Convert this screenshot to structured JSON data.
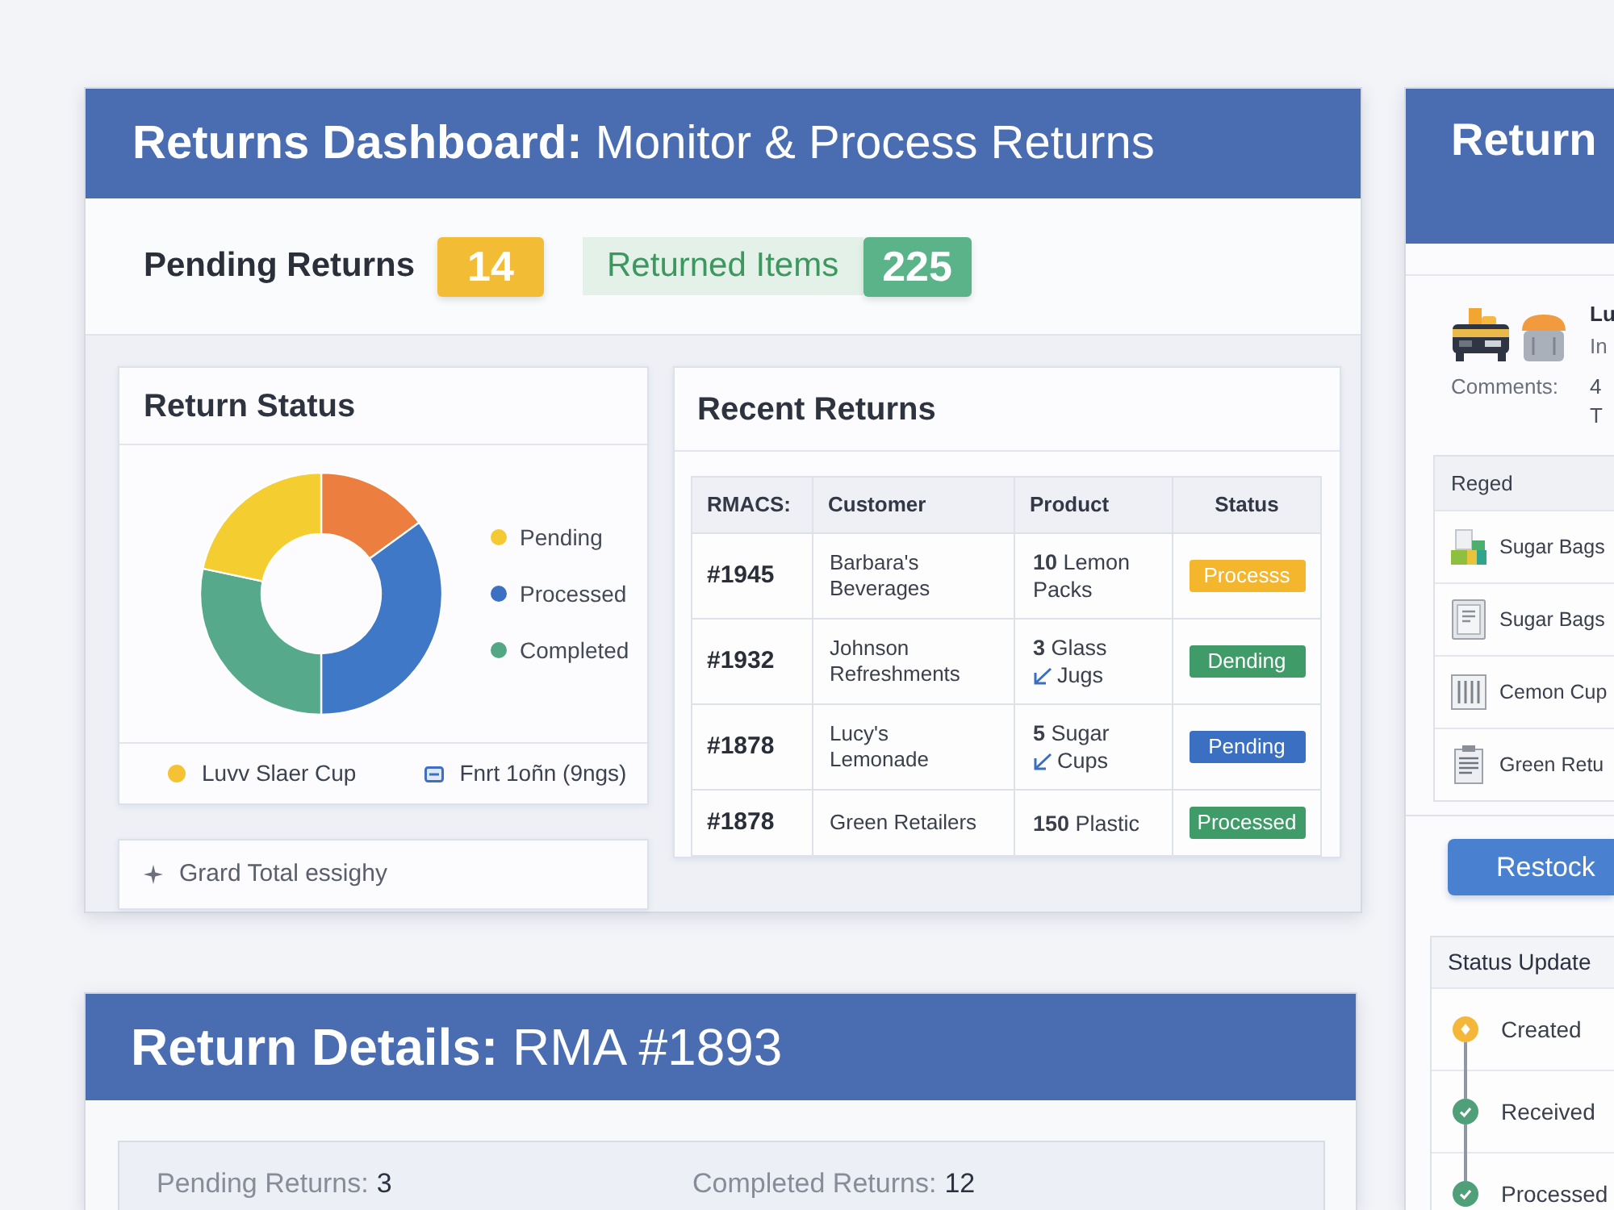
{
  "dashboard": {
    "title": "**Returns Dashboard:** Monitor & Process Returns",
    "stats": [
      {
        "kind": "plain",
        "label": "Pending Returns",
        "value": "14",
        "color": "#f2bc34"
      },
      {
        "kind": "tinted",
        "label": "Returned Items",
        "value": "225",
        "color": "#5bb489"
      }
    ],
    "return_status": {
      "title": "Return Status",
      "legend": [
        {
          "label": "Pending",
          "color": "#f5c933"
        },
        {
          "label": "Processed",
          "color": "#3c70c2"
        },
        {
          "label": "Completed",
          "color": "#52a784"
        }
      ],
      "footer": [
        {
          "kind": "dot",
          "text": "Luvv Slaer Cup",
          "color": "#f4c233"
        },
        {
          "kind": "card",
          "text": "Fnrt 1oñn (9ngs)",
          "color": "#3f6fc4"
        }
      ]
    },
    "grand_total": {
      "text": "Grard Total essighy"
    },
    "recent_returns": {
      "title": "Recent Returns",
      "columns": [
        "RMACS:",
        "Customer",
        "Product",
        "Status"
      ],
      "rows": [
        {
          "rma": "#1945",
          "customer": "Barbara's Beverages",
          "product": {
            "lines": [
              "**10** Lemon",
              "Packs"
            ],
            "check_mark": false
          },
          "status": {
            "text": "Processs",
            "color": "#f3b62c"
          }
        },
        {
          "rma": "#1932",
          "customer": "Johnson Refreshments",
          "product": {
            "lines": [
              "**3** Glass",
              "Jugs"
            ],
            "check_mark": true
          },
          "status": {
            "text": "Dending",
            "color": "#3f9c69"
          }
        },
        {
          "rma": "#1878",
          "customer": "Lucy's Lemonade",
          "product": {
            "lines": [
              "**5** Sugar",
              "Cups"
            ],
            "check_mark": true
          },
          "status": {
            "text": "Pending",
            "color": "#3b6fc1"
          }
        },
        {
          "rma": "#1878",
          "customer": "Green Retailers",
          "product": {
            "lines": [
              "**150** Plastic"
            ],
            "check_mark": false
          },
          "status": {
            "text": "Processed",
            "color": "#3f9c69"
          }
        }
      ]
    }
  },
  "return_details": {
    "title": "**Return Details:** RMA #1893",
    "summary": [
      {
        "label": "Pending Returns:",
        "value": "3"
      },
      {
        "label": "Completed Returns:",
        "value": "12"
      }
    ]
  },
  "side_panel": {
    "title": "Return",
    "heading": "Lu",
    "subheading": "In",
    "comments_label": "Comments:",
    "comment_lines": [
      "4",
      "T"
    ],
    "items_table": {
      "columns": [
        "Reged"
      ],
      "rows": [
        {
          "kind": "boxes",
          "text": "Sugar Bags"
        },
        {
          "kind": "document",
          "text": "Sugar Bags"
        },
        {
          "kind": "columns",
          "text": "Cemon Cup"
        },
        {
          "kind": "clipboard",
          "text": "Green Retu"
        }
      ]
    },
    "button": "Restock",
    "status_updates": {
      "title": "Status Update",
      "steps": [
        {
          "kind": "current",
          "label": "Created",
          "color": "#f4b73a"
        },
        {
          "kind": "done",
          "label": "Received",
          "color": "#4f9f78"
        },
        {
          "kind": "done",
          "label": "Processed",
          "color": "#4f9f78"
        }
      ]
    }
  }
}
